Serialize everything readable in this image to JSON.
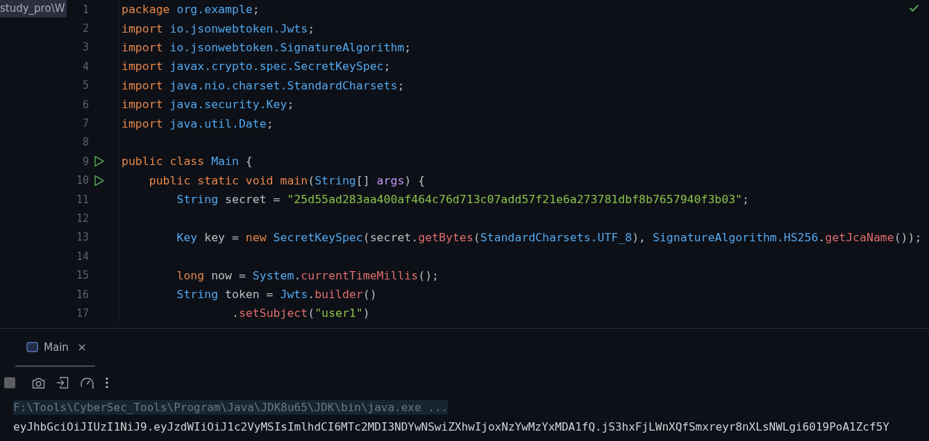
{
  "breadcrumb": "study_pro\\W",
  "inspection_ok": true,
  "code_lines": [
    {
      "number": "1",
      "run": false,
      "tokens": [
        {
          "kind": "kw",
          "text": "package "
        },
        {
          "kind": "ty",
          "text": "org.example"
        },
        {
          "kind": "plain",
          "text": ";"
        }
      ]
    },
    {
      "number": "2",
      "run": false,
      "tokens": [
        {
          "kind": "kw",
          "text": "import "
        },
        {
          "kind": "ty",
          "text": "io.jsonwebtoken.Jwts"
        },
        {
          "kind": "plain",
          "text": ";"
        }
      ]
    },
    {
      "number": "3",
      "run": false,
      "tokens": [
        {
          "kind": "kw",
          "text": "import "
        },
        {
          "kind": "ty",
          "text": "io.jsonwebtoken.SignatureAlgorithm"
        },
        {
          "kind": "plain",
          "text": ";"
        }
      ]
    },
    {
      "number": "4",
      "run": false,
      "tokens": [
        {
          "kind": "kw",
          "text": "import "
        },
        {
          "kind": "ty",
          "text": "javax.crypto.spec.SecretKeySpec"
        },
        {
          "kind": "plain",
          "text": ";"
        }
      ]
    },
    {
      "number": "5",
      "run": false,
      "tokens": [
        {
          "kind": "kw",
          "text": "import "
        },
        {
          "kind": "ty",
          "text": "java.nio.charset.StandardCharsets"
        },
        {
          "kind": "plain",
          "text": ";"
        }
      ]
    },
    {
      "number": "6",
      "run": false,
      "tokens": [
        {
          "kind": "kw",
          "text": "import "
        },
        {
          "kind": "ty",
          "text": "java.security.Key"
        },
        {
          "kind": "plain",
          "text": ";"
        }
      ]
    },
    {
      "number": "7",
      "run": false,
      "tokens": [
        {
          "kind": "kw",
          "text": "import "
        },
        {
          "kind": "ty",
          "text": "java.util.Date"
        },
        {
          "kind": "plain",
          "text": ";"
        }
      ]
    },
    {
      "number": "8",
      "run": false
    },
    {
      "number": "9",
      "run": true,
      "tokens": [
        {
          "kind": "kw",
          "text": "public class "
        },
        {
          "kind": "ty",
          "text": "Main"
        },
        {
          "kind": "plain",
          "text": " {"
        }
      ]
    },
    {
      "number": "10",
      "run": true,
      "tokens": [
        {
          "kind": "kw",
          "text": "    public static void main"
        },
        {
          "kind": "plain",
          "text": "("
        },
        {
          "kind": "ty",
          "text": "String"
        },
        {
          "kind": "plain",
          "text": "[] "
        },
        {
          "kind": "param",
          "text": "args"
        },
        {
          "kind": "plain",
          "text": ") {"
        }
      ]
    },
    {
      "number": "11",
      "run": false,
      "tokens": [
        {
          "kind": "ty",
          "text": "        String"
        },
        {
          "kind": "plain",
          "text": " secret = "
        },
        {
          "kind": "str",
          "text": "\"25d55ad283aa400af464c76d713c07add57f21e6a273781dbf8b7657940f3b03\""
        },
        {
          "kind": "plain",
          "text": ";"
        }
      ]
    },
    {
      "number": "12",
      "run": false
    },
    {
      "number": "13",
      "run": false,
      "tokens": [
        {
          "kind": "ty",
          "text": "        Key"
        },
        {
          "kind": "plain",
          "text": " key = "
        },
        {
          "kind": "kw",
          "text": "new "
        },
        {
          "kind": "ty",
          "text": "SecretKeySpec"
        },
        {
          "kind": "plain",
          "text": "(secret."
        },
        {
          "kind": "fn",
          "text": "getBytes"
        },
        {
          "kind": "plain",
          "text": "("
        },
        {
          "kind": "ty",
          "text": "StandardCharsets.UTF_8"
        },
        {
          "kind": "plain",
          "text": "), "
        },
        {
          "kind": "ty",
          "text": "SignatureAlgorithm.HS256"
        },
        {
          "kind": "plain",
          "text": "."
        },
        {
          "kind": "fn",
          "text": "getJcaName"
        },
        {
          "kind": "plain",
          "text": "());"
        }
      ]
    },
    {
      "number": "14",
      "run": false
    },
    {
      "number": "15",
      "run": false,
      "tokens": [
        {
          "kind": "kw",
          "text": "        long"
        },
        {
          "kind": "plain",
          "text": " now = "
        },
        {
          "kind": "ty",
          "text": "System"
        },
        {
          "kind": "plain",
          "text": "."
        },
        {
          "kind": "fn",
          "text": "currentTimeMillis"
        },
        {
          "kind": "plain",
          "text": "();"
        }
      ]
    },
    {
      "number": "16",
      "run": false,
      "tokens": [
        {
          "kind": "ty",
          "text": "        String"
        },
        {
          "kind": "plain",
          "text": " token = "
        },
        {
          "kind": "ty",
          "text": "Jwts"
        },
        {
          "kind": "plain",
          "text": "."
        },
        {
          "kind": "fn",
          "text": "builder"
        },
        {
          "kind": "plain",
          "text": "()"
        }
      ]
    },
    {
      "number": "17",
      "run": false,
      "tokens": [
        {
          "kind": "plain",
          "text": "                ."
        },
        {
          "kind": "fn",
          "text": "setSubject"
        },
        {
          "kind": "plain",
          "text": "("
        },
        {
          "kind": "str",
          "text": "\"user1\""
        },
        {
          "kind": "plain",
          "text": ")"
        }
      ]
    }
  ],
  "run_tabs": [
    {
      "label": "Main",
      "selected": true
    }
  ],
  "toolbar": [
    {
      "kind": "stop"
    },
    {
      "kind": "camera"
    },
    {
      "kind": "login"
    },
    {
      "kind": "gauge"
    },
    {
      "kind": "more"
    }
  ],
  "console_lines": [
    {
      "kind": "command",
      "text": "F:\\Tools\\CyberSec_Tools\\Program\\Java\\JDK8u65\\JDK\\bin\\java.exe ..."
    },
    {
      "kind": "output",
      "text": "eyJhbGciOiJIUzI1NiJ9.eyJzdWIiOiJ1c2VyMSIsImlhdCI6MTc2MDI3NDYwNSwiZXhwIjoxNzYwMzYxMDA1fQ.jS3hxFjLWnXQfSmxreyr8nXLsNWLgi6019PoA1Zcf5Y"
    }
  ]
}
